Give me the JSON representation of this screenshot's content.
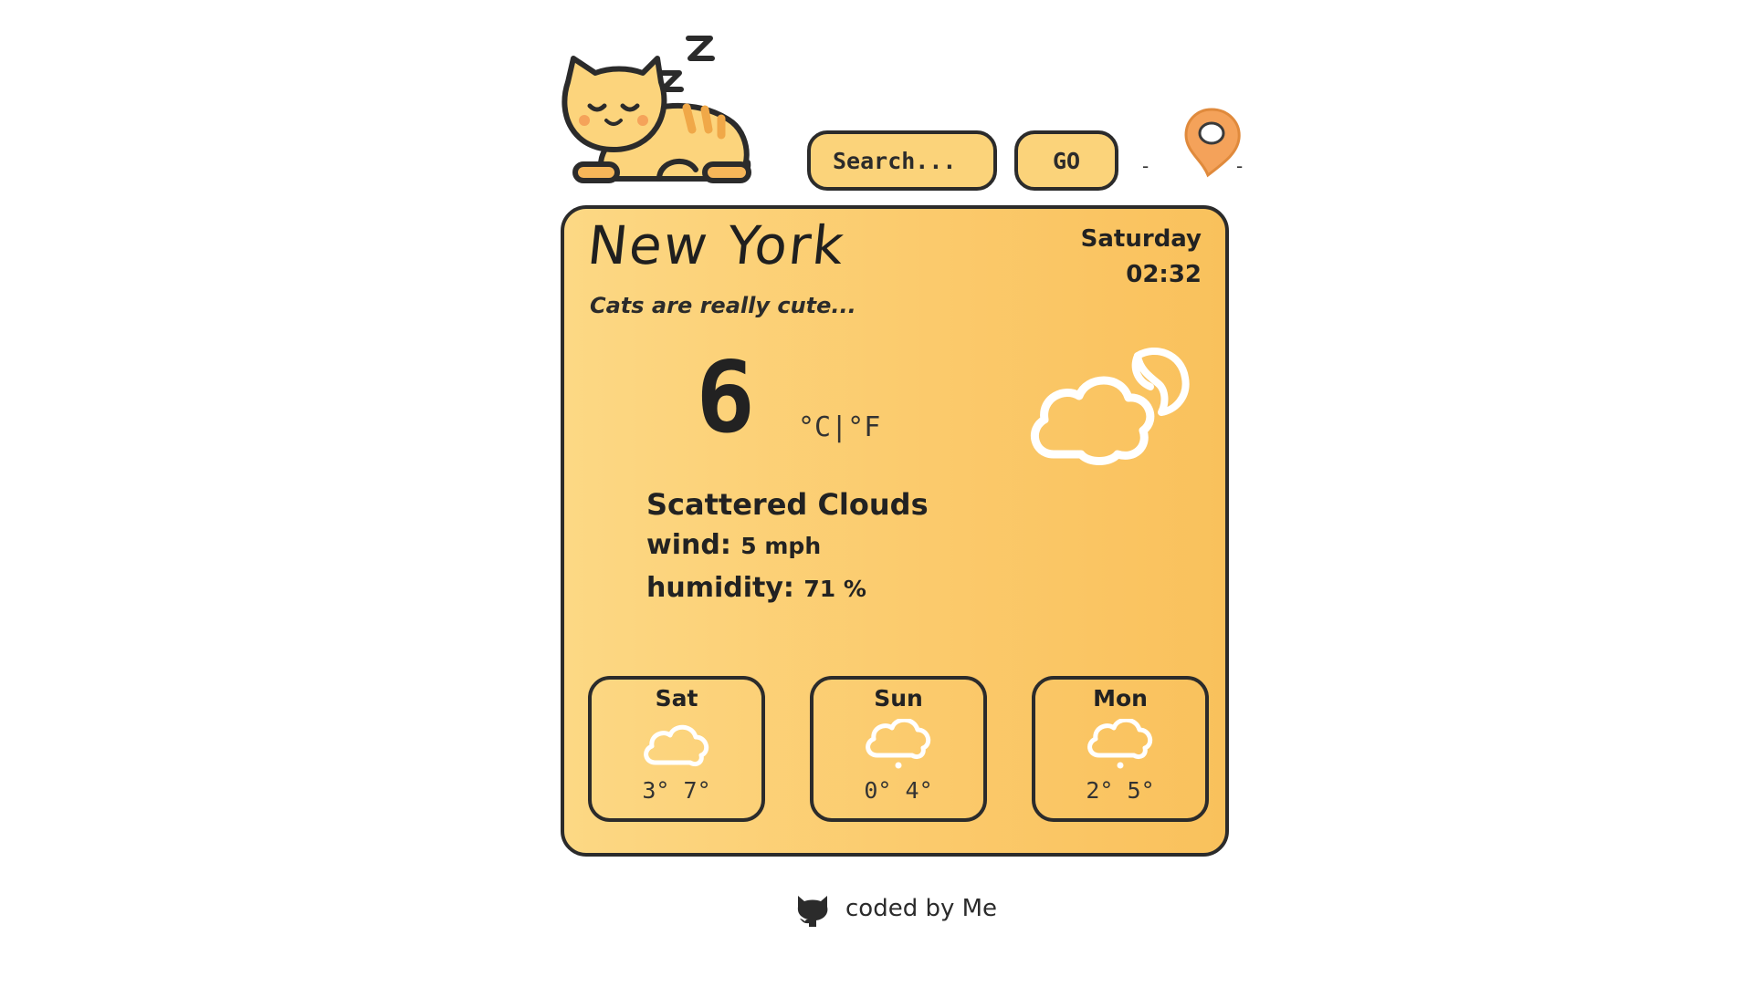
{
  "header": {
    "search_placeholder": "Search...",
    "go_label": "GO",
    "location_icon": "location-pin-icon",
    "logo_icon": "sleeping-cat-icon"
  },
  "card": {
    "city": "New York",
    "day": "Saturday",
    "time": "02:32",
    "tagline": "Cats are really cute...",
    "temperature": "6",
    "units": "°C|°F",
    "condition_icon": "cloud-moon-icon",
    "description": "Scattered Clouds",
    "wind_label": "wind:",
    "wind_value": "5 mph",
    "humidity_label": "humidity:",
    "humidity_value": "71 %"
  },
  "forecast": [
    {
      "day": "Sat",
      "icon": "cloud-icon",
      "temps": "3° 7°"
    },
    {
      "day": "Sun",
      "icon": "cloud-drizzle-icon",
      "temps": "0° 4°"
    },
    {
      "day": "Mon",
      "icon": "cloud-drizzle-icon",
      "temps": "2° 5°"
    }
  ],
  "footer": {
    "text": "coded by Me",
    "icon": "github-icon"
  },
  "colors": {
    "card_gradient_start": "#fcd884",
    "card_gradient_end": "#f9c15c",
    "border": "#2b2b2b",
    "pin": "#f4a25a"
  }
}
